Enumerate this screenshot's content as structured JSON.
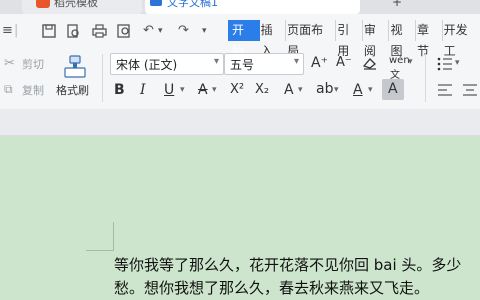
{
  "tabs": [
    {
      "label": "稻壳模板",
      "active": false
    },
    {
      "label": "文字文稿1",
      "active": true
    }
  ],
  "quick_access": {
    "icons": [
      "menu-icon",
      "save-icon",
      "print-preview-icon",
      "print-icon",
      "find-icon",
      "undo-icon",
      "redo-icon",
      "dropdown-icon"
    ]
  },
  "menu": {
    "items": [
      "开始",
      "插入",
      "页面布局",
      "引用",
      "审阅",
      "视图",
      "章节",
      "开发工"
    ],
    "active": "开始"
  },
  "ribbon": {
    "cut_label": "剪切",
    "copy_label": "复制",
    "format_painter_label": "格式刷",
    "font_name": "宋体 (正文)",
    "font_size": "五号",
    "bold": "B",
    "italic": "I",
    "underline": "U",
    "strikethrough": "A",
    "superscript": "X²",
    "subscript": "X₂",
    "font_grow": "A⁺",
    "font_shrink": "A⁻",
    "phonetic": "wén",
    "text_effect": "A",
    "highlight": "ab",
    "font_color": "A",
    "char_shading": "A",
    "accent_color": "#2b7de9"
  },
  "document": {
    "line1": "等你我等了那么久，花开花落不见你回 bai 头。多少",
    "line2": "愁。想你我想了那么久，春去秋来燕来又飞走。"
  }
}
